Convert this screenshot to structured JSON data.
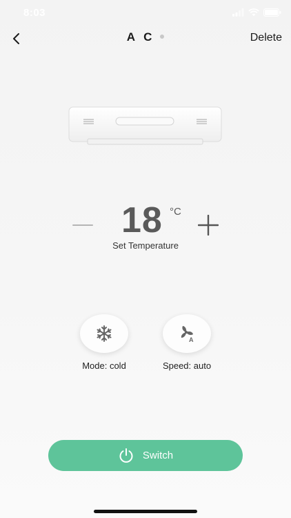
{
  "status_bar": {
    "time": "8:03"
  },
  "header": {
    "title": "A C",
    "delete_label": "Delete",
    "back_icon": "chevron-left-icon"
  },
  "temperature": {
    "value": "18",
    "unit": "°C",
    "label": "Set Temperature"
  },
  "mode": {
    "label": "Mode: cold",
    "icon": "snowflake-icon"
  },
  "speed": {
    "label": "Speed: auto",
    "icon": "fan-auto-icon"
  },
  "switch": {
    "label": "Switch",
    "icon": "power-icon",
    "color": "#5ec49a"
  }
}
